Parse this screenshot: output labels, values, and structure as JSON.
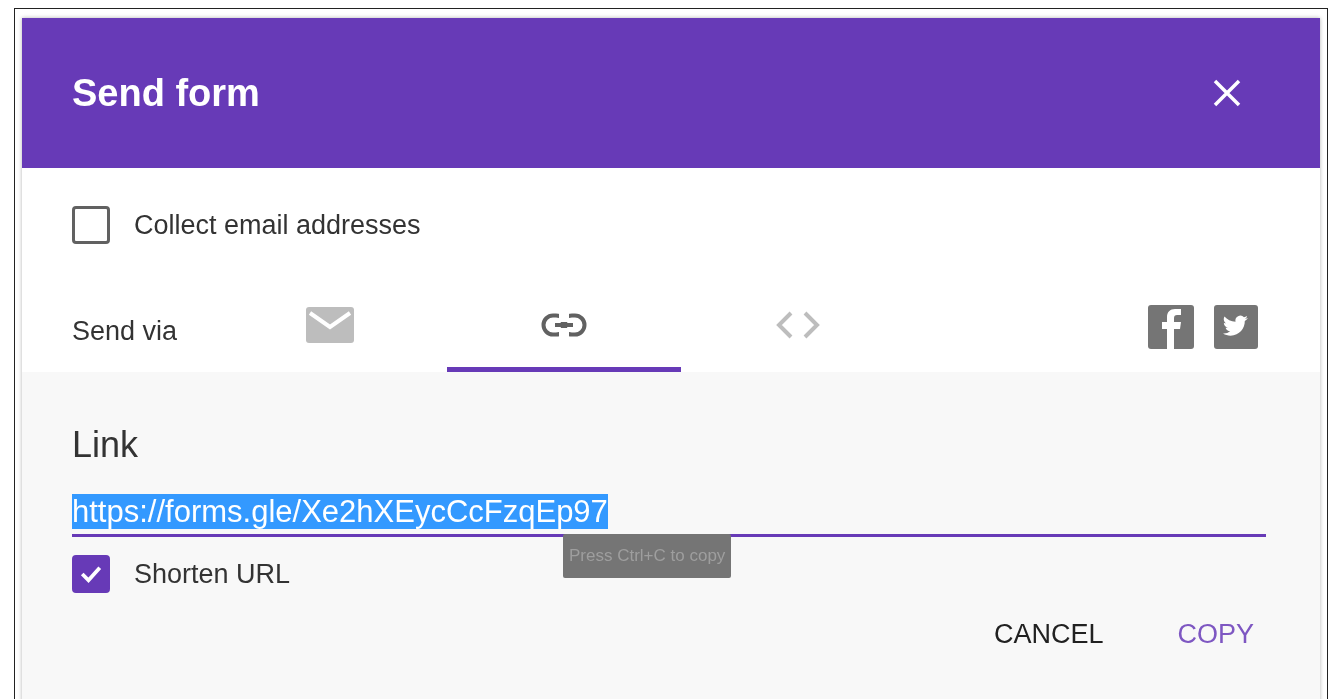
{
  "dialog": {
    "title": "Send form"
  },
  "collect_email": {
    "label": "Collect email addresses",
    "checked": false
  },
  "send_via": {
    "label": "Send via",
    "tabs": [
      {
        "kind": "email",
        "selected": false
      },
      {
        "kind": "link",
        "selected": true
      },
      {
        "kind": "embed",
        "selected": false
      }
    ]
  },
  "link": {
    "heading": "Link",
    "value": "https://forms.gle/Xe2hXEycCcFzqEp97",
    "tooltip": "Press Ctrl+C to copy"
  },
  "shorten_url": {
    "label": "Shorten URL",
    "checked": true
  },
  "buttons": [
    "CANCEL",
    "COPY"
  ]
}
